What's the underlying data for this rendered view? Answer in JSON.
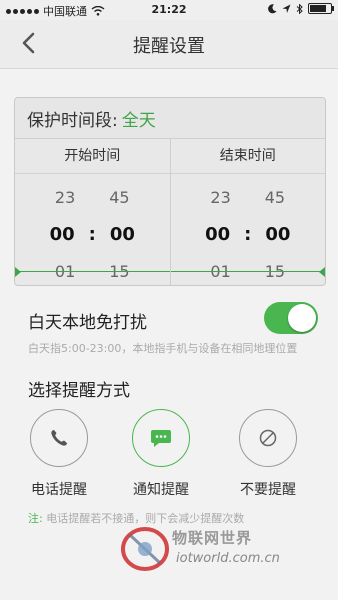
{
  "status_bar": {
    "carrier": "中国联通",
    "time": "21:22",
    "battery_level": 0.9
  },
  "header": {
    "title": "提醒设置"
  },
  "schedule": {
    "period_label": "保护时间段:",
    "period_value": "全天",
    "start": {
      "header": "开始时间",
      "prev_hour": "23",
      "prev_min": "45",
      "hour": "00",
      "separator": ":",
      "minute": "00",
      "next_hour": "01",
      "next_min": "15"
    },
    "end": {
      "header": "结束时间",
      "prev_hour": "23",
      "prev_min": "45",
      "hour": "00",
      "separator": ":",
      "minute": "00",
      "next_hour": "01",
      "next_min": "15"
    }
  },
  "quiet_mode": {
    "label": "白天本地免打扰",
    "description": "白天指5:00-23:00，本地指手机与设备在相同地理位置",
    "enabled": true
  },
  "reminder": {
    "title": "选择提醒方式",
    "options": [
      {
        "label": "电话提醒",
        "icon": "phone-icon",
        "selected": false
      },
      {
        "label": "通知提醒",
        "icon": "chat-icon",
        "selected": true
      },
      {
        "label": "不要提醒",
        "icon": "prohibit-icon",
        "selected": false
      }
    ]
  },
  "note": {
    "prefix": "注:",
    "text": "电话提醒若不接通，则下会减少提醒次数"
  },
  "watermark": {
    "line1": "物联网世界",
    "line2": "iotworld.com.cn"
  },
  "colors": {
    "accent": "#4ab64f",
    "period_value": "#3fa548",
    "background": "#f2f2f2"
  }
}
